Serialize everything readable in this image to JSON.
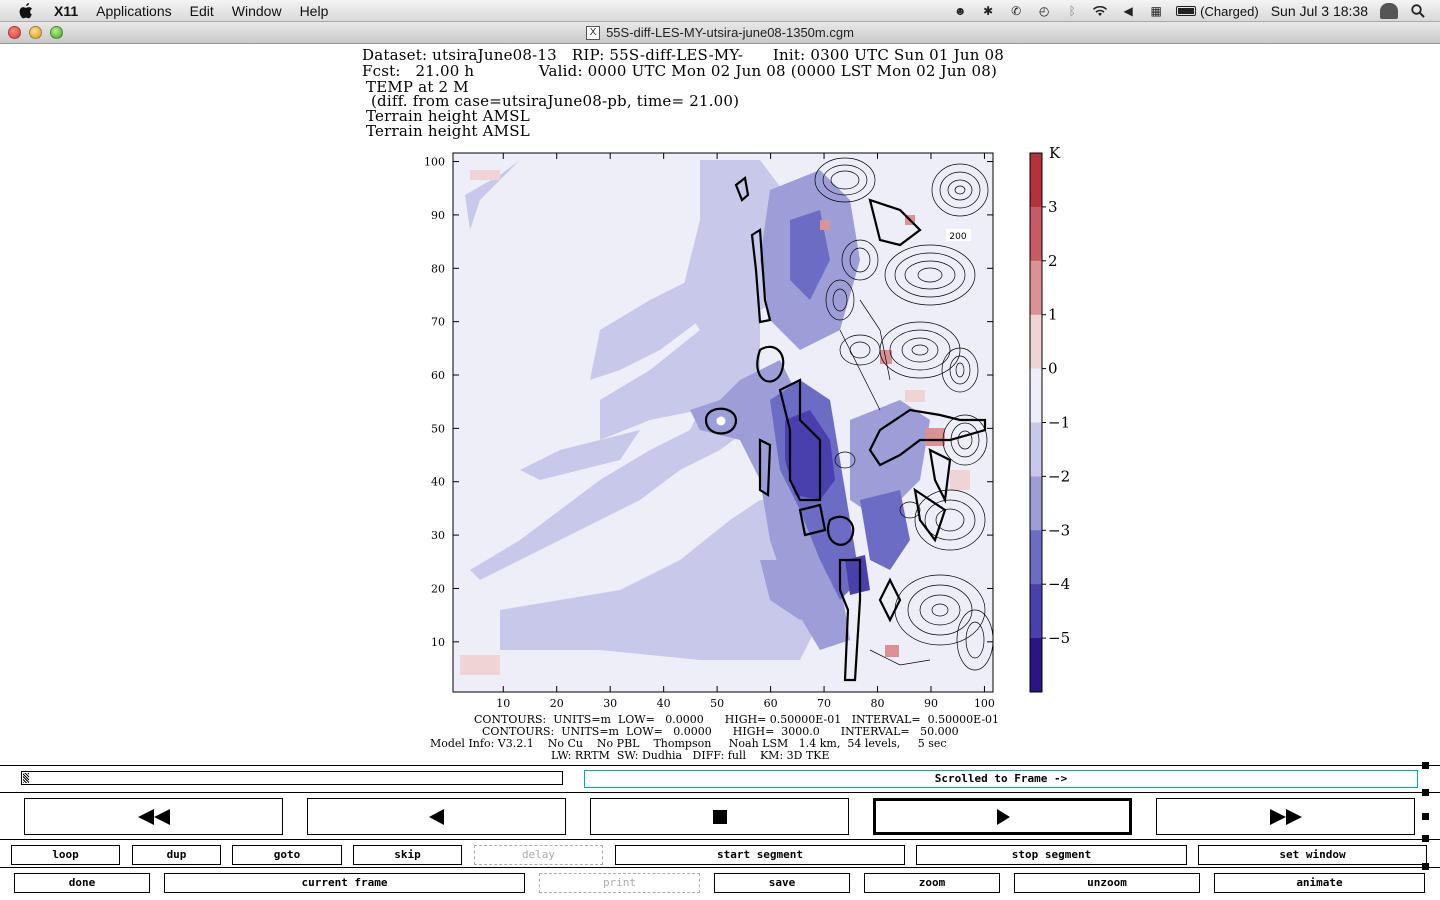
{
  "menubar": {
    "app": "X11",
    "items": [
      "Applications",
      "Edit",
      "Window",
      "Help"
    ],
    "battery": "(Charged)",
    "datetime": "Sun Jul 3  18:38"
  },
  "window": {
    "title": "55S-diff-LES-MY-utsira-june08-1350m.cgm"
  },
  "header": {
    "line1": "Dataset: utsiraJune08-13   RIP: 55S-diff-LES-MY-      Init: 0300 UTC Sun 01 Jun 08",
    "line2": "Fcst:   21.00 h             Valid: 0000 UTC Mon 02 Jun 08 (0000 LST Mon 02 Jun 08)",
    "line3": "TEMP at 2 M",
    "line4": " (diff. from case=utsiraJune08-pb, time= 21.00)",
    "line5": "Terrain height AMSL",
    "line6": "Terrain height AMSL"
  },
  "plot": {
    "x_ticks": [
      "10",
      "20",
      "30",
      "40",
      "50",
      "60",
      "70",
      "80",
      "90",
      "100"
    ],
    "y_ticks": [
      "10",
      "20",
      "30",
      "40",
      "50",
      "60",
      "70",
      "80",
      "90",
      "100"
    ],
    "contour_label": "200",
    "colorbar": {
      "unit": "K",
      "labels": [
        "3",
        "2",
        "1",
        "0",
        "−1",
        "−2",
        "−3",
        "−4",
        "−5"
      ],
      "colors": [
        "#b5323c",
        "#c75a63",
        "#dc9197",
        "#f0d3d5",
        "#eeeef8",
        "#c8c8ea",
        "#9d9dd8",
        "#6d6cc4",
        "#4a40ad",
        "#2a1486"
      ]
    }
  },
  "footer": {
    "line1": "CONTOURS:  UNITS=m  LOW=   0.0000      HIGH= 0.50000E-01   INTERVAL=  0.50000E-01",
    "line2": "CONTOURS:  UNITS=m  LOW=   0.0000      HIGH=  3000.0      INTERVAL=   50.000",
    "line3": "Model Info: V3.2.1    No Cu    No PBL    Thompson     Noah LSM   1.4 km,  54 levels,     5 sec",
    "line4": "LW: RRTM  SW: Dudhia   DIFF: full    KM: 3D TKE"
  },
  "controls": {
    "status": "Scrolled to Frame ->",
    "row1": [
      "loop",
      "dup",
      "goto",
      "skip",
      "delay",
      "start segment",
      "stop segment",
      "set window"
    ],
    "row2": [
      "done",
      "current frame",
      "print",
      "save",
      "zoom",
      "unzoom",
      "animate"
    ]
  }
}
